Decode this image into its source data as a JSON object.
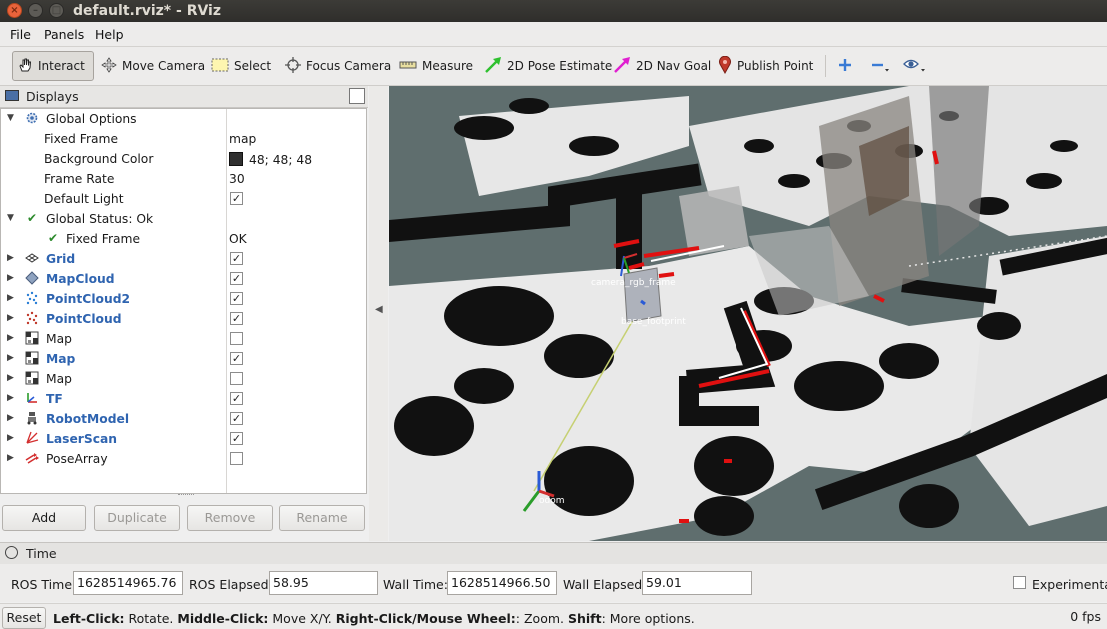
{
  "window": {
    "title": "default.rviz* - RViz"
  },
  "menu": {
    "file": "File",
    "panels": "Panels",
    "help": "Help"
  },
  "toolbar": {
    "interact": "Interact",
    "move_camera": "Move Camera",
    "select": "Select",
    "focus_camera": "Focus Camera",
    "measure": "Measure",
    "pose_estimate": "2D Pose Estimate",
    "nav_goal": "2D Nav Goal",
    "publish_point": "Publish Point"
  },
  "displays": {
    "title": "Displays",
    "global_options": {
      "label": "Global Options",
      "fixed_frame_label": "Fixed Frame",
      "fixed_frame_value": "map",
      "background_color_label": "Background Color",
      "background_color_value": "48; 48; 48",
      "background_color_hex": "#303030",
      "frame_rate_label": "Frame Rate",
      "frame_rate_value": "30",
      "default_light_label": "Default Light",
      "default_light_checked": true
    },
    "global_status": {
      "label": "Global Status: Ok",
      "fixed_frame_label": "Fixed Frame",
      "fixed_frame_value": "OK"
    },
    "items": [
      {
        "name": "Grid",
        "checked": true,
        "highlight": true,
        "icon": "grid-icon"
      },
      {
        "name": "MapCloud",
        "checked": true,
        "highlight": true,
        "icon": "mapcloud-icon"
      },
      {
        "name": "PointCloud2",
        "checked": true,
        "highlight": true,
        "icon": "pointcloud2-icon"
      },
      {
        "name": "PointCloud",
        "checked": true,
        "highlight": true,
        "icon": "pointcloud-icon"
      },
      {
        "name": "Map",
        "checked": false,
        "highlight": false,
        "icon": "map-icon"
      },
      {
        "name": "Map",
        "checked": true,
        "highlight": true,
        "icon": "map-icon"
      },
      {
        "name": "Map",
        "checked": false,
        "highlight": false,
        "icon": "map-icon"
      },
      {
        "name": "TF",
        "checked": true,
        "highlight": true,
        "icon": "tf-icon"
      },
      {
        "name": "RobotModel",
        "checked": true,
        "highlight": true,
        "icon": "robot-model-icon"
      },
      {
        "name": "LaserScan",
        "checked": true,
        "highlight": true,
        "icon": "laserscan-icon"
      },
      {
        "name": "PoseArray",
        "checked": false,
        "highlight": false,
        "icon": "posearray-icon"
      }
    ],
    "buttons": {
      "add": "Add",
      "duplicate": "Duplicate",
      "remove": "Remove",
      "rename": "Rename"
    }
  },
  "viewport": {
    "labels": {
      "camera_frame": "camera_rgb_frame",
      "base_footprint": "base_footprint",
      "odom": "odom"
    }
  },
  "time": {
    "title": "Time",
    "ros_time_label": "ROS Time:",
    "ros_time_value": "1628514965.76",
    "ros_elapsed_label": "ROS Elapsed:",
    "ros_elapsed_value": "58.95",
    "wall_time_label": "Wall Time:",
    "wall_time_value": "1628514966.50",
    "wall_elapsed_label": "Wall Elapsed:",
    "wall_elapsed_value": "59.01",
    "experimental_label": "Experimental"
  },
  "status": {
    "reset": "Reset",
    "hint_left_click": "Left-Click:",
    "hint_rotate": " Rotate. ",
    "hint_middle_click": "Middle-Click:",
    "hint_move": " Move X/Y. ",
    "hint_right_click": "Right-Click/Mouse Wheel:",
    "hint_zoom": ": Zoom. ",
    "hint_shift": "Shift",
    "hint_more": ": More options.",
    "fps": "0 fps"
  }
}
